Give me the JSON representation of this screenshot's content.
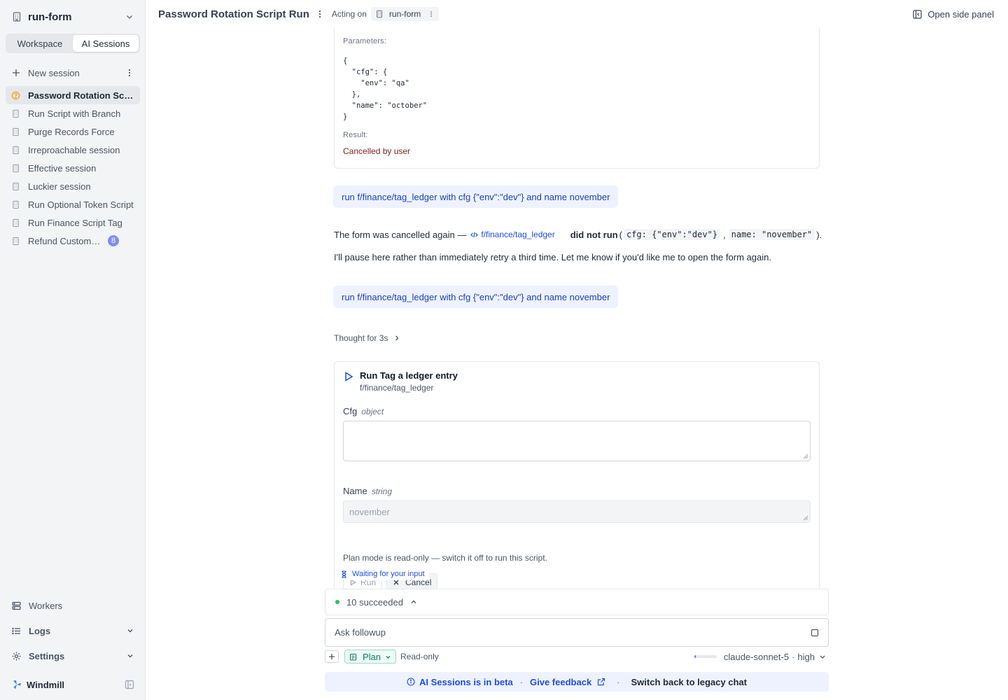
{
  "sidebar": {
    "workspace_name": "run-form",
    "tabs": [
      {
        "label": "Workspace",
        "active": false
      },
      {
        "label": "AI Sessions",
        "active": true
      }
    ],
    "new_session_label": "New session",
    "sessions": [
      {
        "label": "Password Rotation Script Run",
        "active": true,
        "status": "pending",
        "badge": ""
      },
      {
        "label": "Run Script with Branch",
        "active": false,
        "status": "",
        "badge": ""
      },
      {
        "label": "Purge Records Force",
        "active": false,
        "status": "",
        "badge": ""
      },
      {
        "label": "Irreproachable session",
        "active": false,
        "status": "",
        "badge": ""
      },
      {
        "label": "Effective session",
        "active": false,
        "status": "",
        "badge": ""
      },
      {
        "label": "Luckier session",
        "active": false,
        "status": "",
        "badge": ""
      },
      {
        "label": "Run Optional Token Script",
        "active": false,
        "status": "",
        "badge": ""
      },
      {
        "label": "Run Finance Script Tag",
        "active": false,
        "status": "",
        "badge": ""
      },
      {
        "label": "Refund Customer Order",
        "active": false,
        "status": "",
        "badge": "8"
      }
    ],
    "workers_label": "Workers",
    "logs_label": "Logs",
    "settings_label": "Settings",
    "brand_label": "Windmill"
  },
  "header": {
    "title": "Password Rotation Script Run",
    "acting_on_label": "Acting on",
    "acting_on_chip": "run-form",
    "side_panel_label": "Open side panel"
  },
  "result_card": {
    "parameters_label": "Parameters:",
    "parameters_json": "{\n  \"cfg\": {\n    \"env\": \"qa\"\n  },\n  \"name\": \"october\"\n}",
    "result_label": "Result:",
    "result_value": "Cancelled by user"
  },
  "messages": {
    "user_1": "run f/finance/tag_ledger with cfg {\"env\":\"dev\"} and name november",
    "assistant_1": {
      "prefix": "The form was cancelled again —",
      "script_link": "f/finance/tag_ledger",
      "bold": "did not run",
      "open_paren": "(",
      "code_1": "cfg: {\"env\":\"dev\"}",
      "comma": ",",
      "code_2": "name: \"november\"",
      "close_paren": ").",
      "line_2": "I'll pause here rather than immediately retry a third time. Let me know if you'd like me to open the form again."
    },
    "user_2": "run f/finance/tag_ledger with cfg {\"env\":\"dev\"} and name november",
    "thought_label": "Thought for 3s"
  },
  "run_form": {
    "title": "Run Tag a ledger entry",
    "path": "f/finance/tag_ledger",
    "cfg_label": "Cfg",
    "cfg_type": "object",
    "cfg_value": "",
    "name_label": "Name",
    "name_type": "string",
    "name_value": "november",
    "plan_note": "Plan mode is read-only — switch it off to run this script.",
    "run_label": "Run",
    "cancel_label": "Cancel",
    "waiting_label": "Waiting for your input"
  },
  "composer": {
    "status_label": "10 succeeded",
    "input_placeholder": "Ask followup",
    "plan_label": "Plan",
    "readonly_label": "Read-only",
    "context_usage": 0.06,
    "model_label": "claude-sonnet-5",
    "effort_label": "high"
  },
  "beta_bar": {
    "beta_text": "AI Sessions is in beta",
    "feedback_label": "Give feedback",
    "legacy_label": "Switch back to legacy chat"
  },
  "colors": {
    "accent": "#1d4ed8",
    "user_bubble": "#eef2ff",
    "plan_green": "#0f766e",
    "error_text": "#7f1d1d",
    "success_dot": "#22c55e",
    "badge": "#818cf8"
  }
}
